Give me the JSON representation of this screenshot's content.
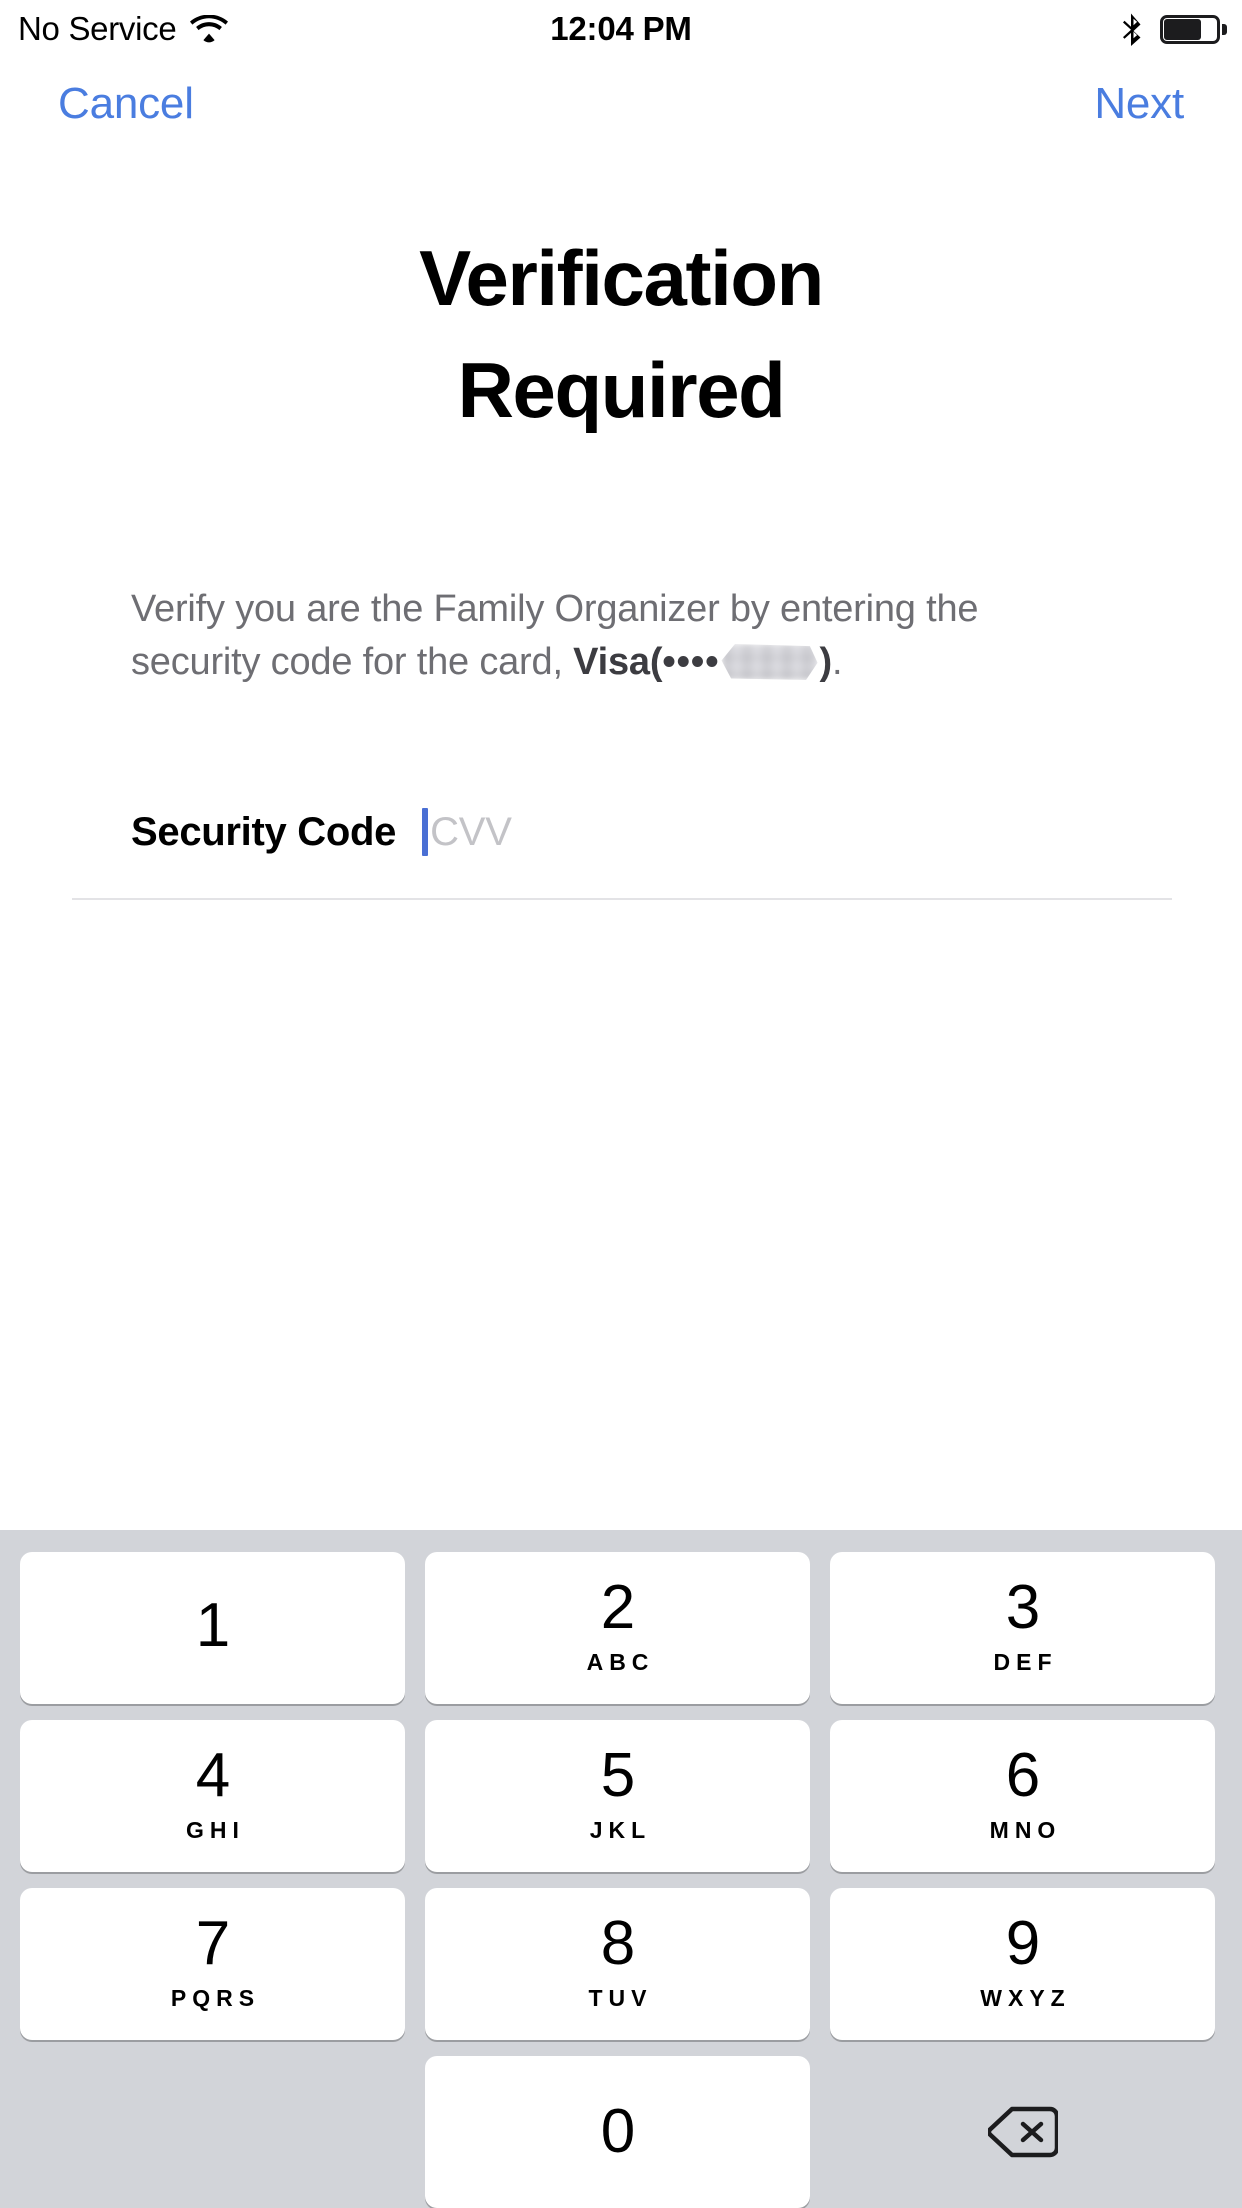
{
  "status_bar": {
    "carrier": "No Service",
    "wifi_icon": "wifi-icon",
    "time": "12:04 PM",
    "bluetooth_icon": "bluetooth-icon",
    "battery_icon": "battery-icon",
    "battery_level_percent": 62
  },
  "nav": {
    "cancel_label": "Cancel",
    "next_label": "Next",
    "accent_color": "#4a7de0"
  },
  "page": {
    "title_line1": "Verification",
    "title_line2": "Required",
    "body_prefix": "Verify you are the Family Organizer by entering the security code for the card, ",
    "card_brand": "Visa",
    "card_open_paren": "(",
    "card_masked_dots": "••••",
    "card_digits_redacted": "",
    "card_close_paren": ")",
    "body_suffix": "."
  },
  "security_code_field": {
    "label": "Security Code",
    "value": "",
    "placeholder": "CVV",
    "caret_color": "#4a6fd4"
  },
  "keyboard": {
    "background_color": "#d2d4d9",
    "key_color": "#ffffff",
    "rows": [
      [
        {
          "digit": "1",
          "letters": ""
        },
        {
          "digit": "2",
          "letters": "ABC"
        },
        {
          "digit": "3",
          "letters": "DEF"
        }
      ],
      [
        {
          "digit": "4",
          "letters": "GHI"
        },
        {
          "digit": "5",
          "letters": "JKL"
        },
        {
          "digit": "6",
          "letters": "MNO"
        }
      ],
      [
        {
          "digit": "7",
          "letters": "PQRS"
        },
        {
          "digit": "8",
          "letters": "TUV"
        },
        {
          "digit": "9",
          "letters": "WXYZ"
        }
      ]
    ],
    "zero_key": {
      "digit": "0",
      "letters": ""
    },
    "delete_icon": "delete-backspace-icon"
  }
}
